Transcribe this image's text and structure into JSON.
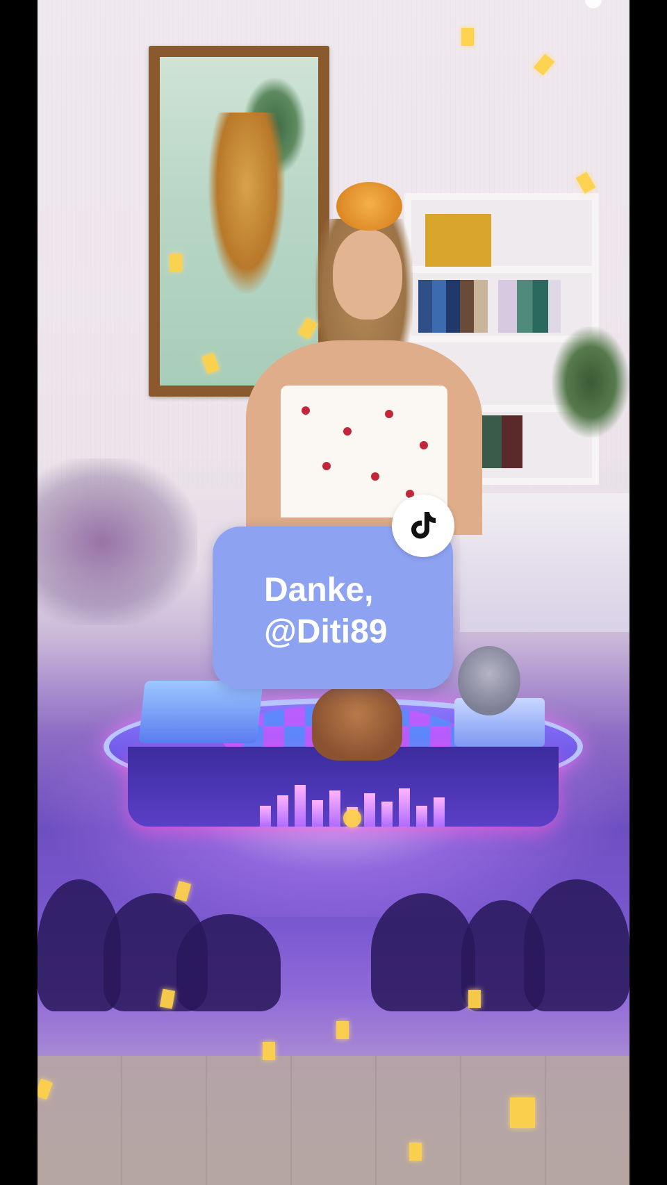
{
  "overlay": {
    "thanks_message": "Danke,\n@Diti89",
    "card_color": "#8ea2f2",
    "badge_icon": "tiktok-logo-icon"
  },
  "colors": {
    "card": "#8ea2f2",
    "stage_purple": "#6e4fc0",
    "confetti": "#ffd24a"
  }
}
